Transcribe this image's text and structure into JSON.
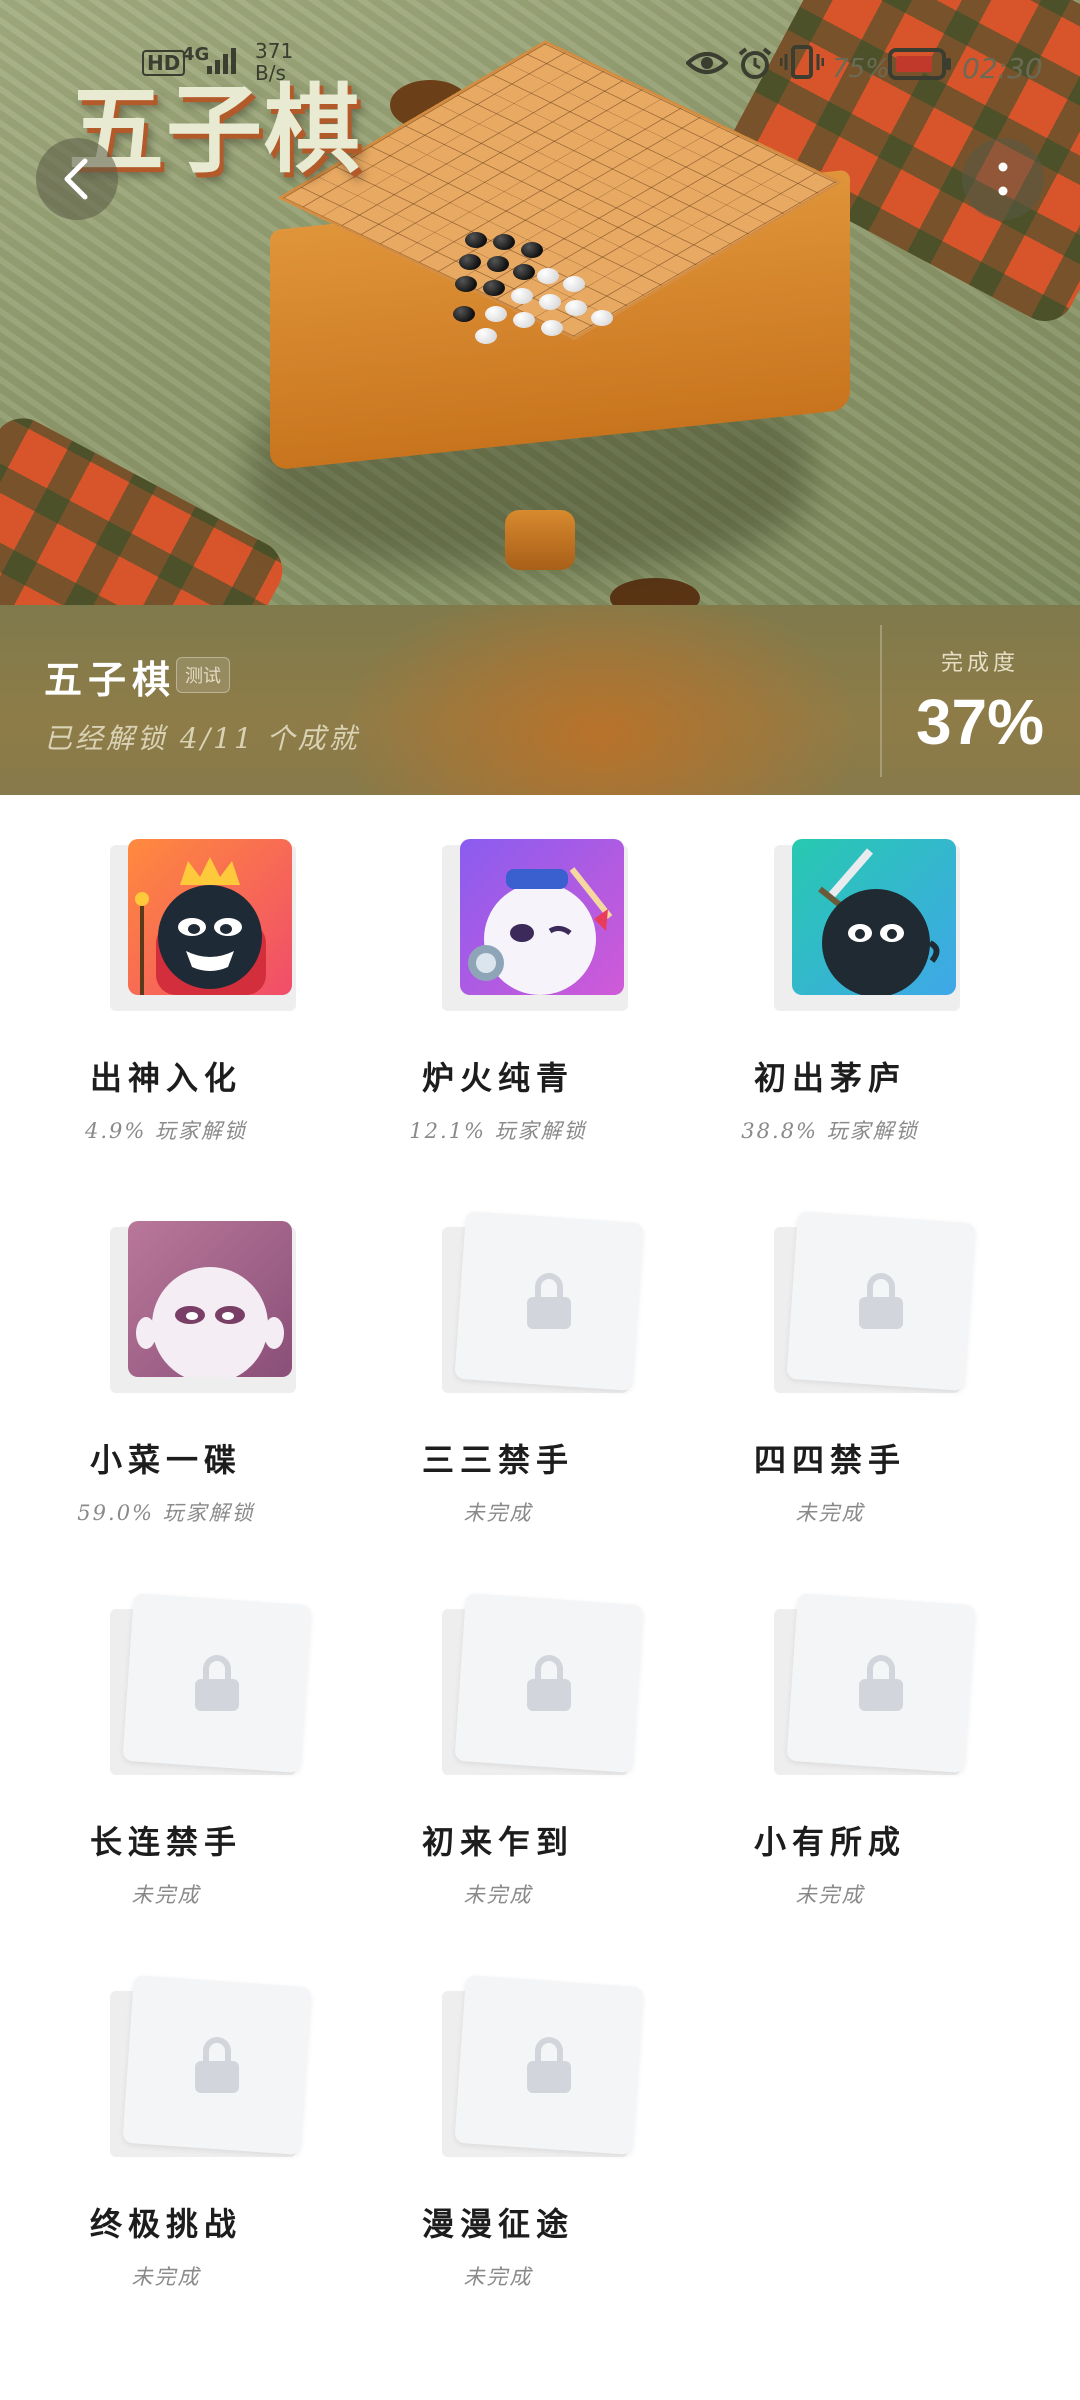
{
  "status_bar": {
    "hd": "HD",
    "network": "4G",
    "speed_value": "371",
    "speed_unit": "B/s",
    "battery_percent": "75%",
    "time": "02:30"
  },
  "hero": {
    "title": "五子棋"
  },
  "summary": {
    "game_name": "五子棋",
    "badge": "测试",
    "unlocked_text": "已经解锁 4/11 个成就",
    "completion_label": "完成度",
    "completion_value": "37%"
  },
  "achievements": [
    {
      "title": "出神入化",
      "subtitle": "4.9% 玩家解锁",
      "locked": false,
      "theme": "king"
    },
    {
      "title": "炉火纯青",
      "subtitle": "12.1% 玩家解锁",
      "locked": false,
      "theme": "white-knight"
    },
    {
      "title": "初出茅庐",
      "subtitle": "38.8% 玩家解锁",
      "locked": false,
      "theme": "sword"
    },
    {
      "title": "小菜一碟",
      "subtitle": "59.0% 玩家解锁",
      "locked": false,
      "theme": "white-ghost"
    },
    {
      "title": "三三禁手",
      "subtitle": "未完成",
      "locked": true
    },
    {
      "title": "四四禁手",
      "subtitle": "未完成",
      "locked": true
    },
    {
      "title": "长连禁手",
      "subtitle": "未完成",
      "locked": true
    },
    {
      "title": "初来乍到",
      "subtitle": "未完成",
      "locked": true
    },
    {
      "title": "小有所成",
      "subtitle": "未完成",
      "locked": true
    },
    {
      "title": "终极挑战",
      "subtitle": "未完成",
      "locked": true
    },
    {
      "title": "漫漫征途",
      "subtitle": "未完成",
      "locked": true
    }
  ],
  "icons": {
    "back": "chevron-left-icon",
    "more": "more-vertical-icon",
    "lock": "lock-icon"
  },
  "colors": {
    "summary_band": "#877a4a",
    "completion_text": "#ffffff",
    "locked_card": "#f4f5f7"
  }
}
